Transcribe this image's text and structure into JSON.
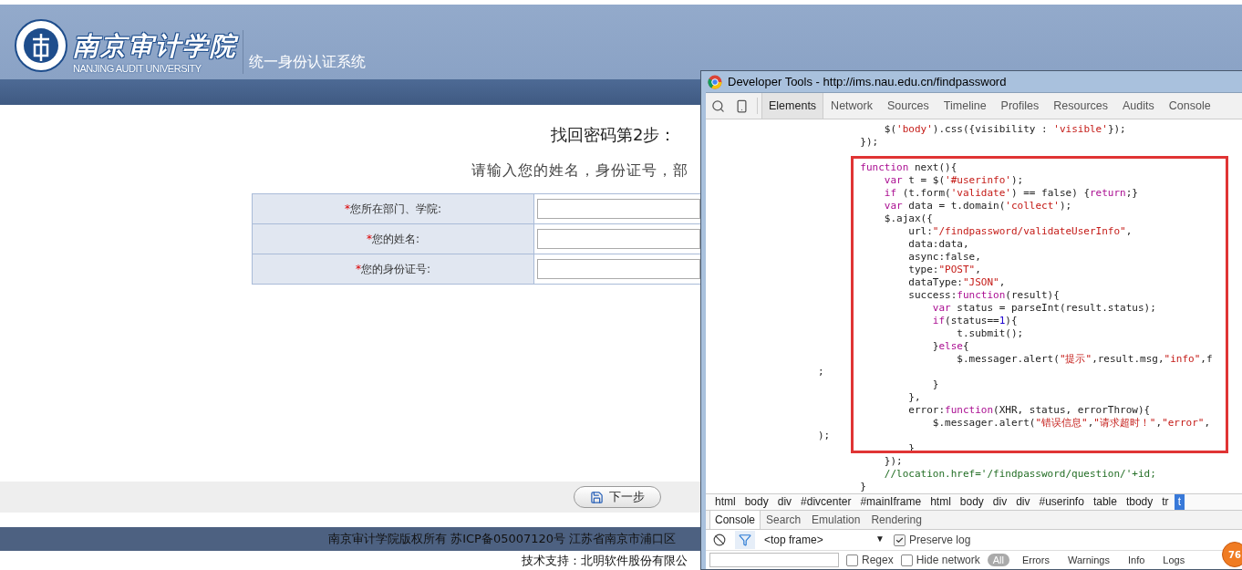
{
  "header": {
    "logo_name": "南京审计学院",
    "logo_subtitle": "NANJING AUDIT UNIVERSITY",
    "system_name": "统一身份认证系统"
  },
  "form": {
    "title": "找回密码第2步：",
    "instruction": "请输入您的姓名，身份证号，部",
    "fields": [
      {
        "required_mark": "*",
        "label": "您所在部门、学院:"
      },
      {
        "required_mark": "*",
        "label": "您的姓名:"
      },
      {
        "required_mark": "*",
        "label": "您的身份证号:"
      }
    ]
  },
  "next_button": "下一步",
  "footer": [
    "南京审计学院版权所有 苏ICP备05007120号 江苏省南京市浦口区",
    "技术支持：北明软件股份有限公"
  ],
  "devtools": {
    "title": "Developer Tools - http://ims.nau.edu.cn/findpassword",
    "tabs": [
      {
        "label": "Elements",
        "selected": true
      },
      {
        "label": "Network",
        "selected": false
      },
      {
        "label": "Sources",
        "selected": false
      },
      {
        "label": "Timeline",
        "selected": false
      },
      {
        "label": "Profiles",
        "selected": false
      },
      {
        "label": "Resources",
        "selected": false
      },
      {
        "label": "Audits",
        "selected": false
      },
      {
        "label": "Console",
        "selected": false
      }
    ],
    "code_blocks": [
      {
        "lines": [
          [
            {
              "kind": "plain",
              "text": "                           $("
            },
            {
              "kind": "string",
              "text": "'body'"
            },
            {
              "kind": "plain",
              "text": ").css({visibility : "
            },
            {
              "kind": "string",
              "text": "'visible'"
            },
            {
              "kind": "plain",
              "text": "});"
            }
          ],
          [
            {
              "kind": "plain",
              "text": "                       });"
            }
          ]
        ]
      },
      {
        "lines": [
          [
            {
              "kind": "keyword",
              "text": "                       function"
            },
            {
              "kind": "plain",
              "text": " next(){"
            }
          ],
          [
            {
              "kind": "keyword",
              "text": "                           var"
            },
            {
              "kind": "plain",
              "text": " t = $("
            },
            {
              "kind": "string",
              "text": "'#userinfo'"
            },
            {
              "kind": "plain",
              "text": ");"
            }
          ],
          [
            {
              "kind": "keyword",
              "text": "                           if"
            },
            {
              "kind": "plain",
              "text": " (t.form("
            },
            {
              "kind": "string",
              "text": "'validate'"
            },
            {
              "kind": "plain",
              "text": ") == false) {"
            },
            {
              "kind": "keyword",
              "text": "return"
            },
            {
              "kind": "plain",
              "text": ";}"
            }
          ],
          [
            {
              "kind": "keyword",
              "text": "                           var"
            },
            {
              "kind": "plain",
              "text": " data = t.domain("
            },
            {
              "kind": "string",
              "text": "'collect'"
            },
            {
              "kind": "plain",
              "text": ");"
            }
          ],
          [
            {
              "kind": "plain",
              "text": "                           $.ajax({"
            }
          ],
          [
            {
              "kind": "plain",
              "text": "                               url:"
            },
            {
              "kind": "string",
              "text": "\"/findpassword/validateUserInfo\""
            },
            {
              "kind": "plain",
              "text": ","
            }
          ],
          [
            {
              "kind": "plain",
              "text": "                               data:data,"
            }
          ],
          [
            {
              "kind": "plain",
              "text": "                               async:false,"
            }
          ],
          [
            {
              "kind": "plain",
              "text": "                               type:"
            },
            {
              "kind": "string",
              "text": "\"POST\""
            },
            {
              "kind": "plain",
              "text": ","
            }
          ],
          [
            {
              "kind": "plain",
              "text": "                               dataType:"
            },
            {
              "kind": "string",
              "text": "\"JSON\""
            },
            {
              "kind": "plain",
              "text": ","
            }
          ],
          [
            {
              "kind": "plain",
              "text": "                               success:"
            },
            {
              "kind": "keyword",
              "text": "function"
            },
            {
              "kind": "plain",
              "text": "(result){"
            }
          ],
          [
            {
              "kind": "keyword",
              "text": "                                   var"
            },
            {
              "kind": "plain",
              "text": " status = parseInt(result.status);"
            }
          ],
          [
            {
              "kind": "keyword",
              "text": "                                   if"
            },
            {
              "kind": "plain",
              "text": "(status=="
            },
            {
              "kind": "number",
              "text": "1"
            },
            {
              "kind": "plain",
              "text": "){"
            }
          ],
          [
            {
              "kind": "plain",
              "text": "                                       t.submit();"
            }
          ],
          [
            {
              "kind": "plain",
              "text": "                                   }"
            },
            {
              "kind": "keyword",
              "text": "else"
            },
            {
              "kind": "plain",
              "text": "{"
            }
          ],
          [
            {
              "kind": "plain",
              "text": "                                       $.messager.alert("
            },
            {
              "kind": "string",
              "text": "\"提示\""
            },
            {
              "kind": "plain",
              "text": ",result.msg,"
            },
            {
              "kind": "string",
              "text": "\"info\""
            },
            {
              "kind": "plain",
              "text": ",f"
            }
          ],
          [
            {
              "kind": "plain",
              "text": "                ;"
            }
          ],
          [
            {
              "kind": "plain",
              "text": "                                   }"
            }
          ],
          [
            {
              "kind": "plain",
              "text": "                               },"
            }
          ],
          [
            {
              "kind": "plain",
              "text": "                               error:"
            },
            {
              "kind": "keyword",
              "text": "function"
            },
            {
              "kind": "plain",
              "text": "(XHR, status, errorThrow){"
            }
          ],
          [
            {
              "kind": "plain",
              "text": "                                   $.messager.alert("
            },
            {
              "kind": "string",
              "text": "\"错误信息\""
            },
            {
              "kind": "plain",
              "text": ","
            },
            {
              "kind": "string",
              "text": "\"请求超时！\""
            },
            {
              "kind": "plain",
              "text": ","
            },
            {
              "kind": "string",
              "text": "\"error\""
            },
            {
              "kind": "plain",
              "text": ","
            }
          ],
          [
            {
              "kind": "plain",
              "text": "                );"
            }
          ],
          [
            {
              "kind": "plain",
              "text": "                               }"
            }
          ],
          [
            {
              "kind": "plain",
              "text": "                           });"
            }
          ],
          [
            {
              "kind": "comment",
              "text": "                           //location.href='/findpassword/question/'+id;"
            }
          ],
          [
            {
              "kind": "plain",
              "text": "                       }"
            }
          ]
        ]
      }
    ],
    "breadcrumb": [
      {
        "label": "html",
        "selected": false
      },
      {
        "label": "body",
        "selected": false
      },
      {
        "label": "div",
        "selected": false
      },
      {
        "label": "#divcenter",
        "selected": false
      },
      {
        "label": "#mainIframe",
        "selected": false
      },
      {
        "label": "html",
        "selected": false
      },
      {
        "label": "body",
        "selected": false
      },
      {
        "label": "div",
        "selected": false
      },
      {
        "label": "div",
        "selected": false
      },
      {
        "label": "#userinfo",
        "selected": false
      },
      {
        "label": "table",
        "selected": false
      },
      {
        "label": "tbody",
        "selected": false
      },
      {
        "label": "tr",
        "selected": false
      },
      {
        "label": "t",
        "selected": true
      }
    ],
    "drawer_tabs": [
      {
        "label": "Console",
        "selected": true
      },
      {
        "label": "Search",
        "selected": false
      },
      {
        "label": "Emulation",
        "selected": false
      },
      {
        "label": "Rendering",
        "selected": false
      }
    ],
    "console": {
      "filter_active": true,
      "context": "<top frame>",
      "dropdown_arrow": "▼",
      "preserve_log": {
        "label": "Preserve log",
        "checked": true
      },
      "options": [
        {
          "label": "Regex",
          "checked": false
        },
        {
          "label": "Hide network",
          "checked": false
        }
      ],
      "levels": [
        {
          "label": "All",
          "selected": true
        },
        {
          "label": "Errors",
          "selected": false
        },
        {
          "label": "Warnings",
          "selected": false
        },
        {
          "label": "Info",
          "selected": false
        },
        {
          "label": "Logs",
          "selected": false
        }
      ]
    }
  },
  "badge": "76"
}
